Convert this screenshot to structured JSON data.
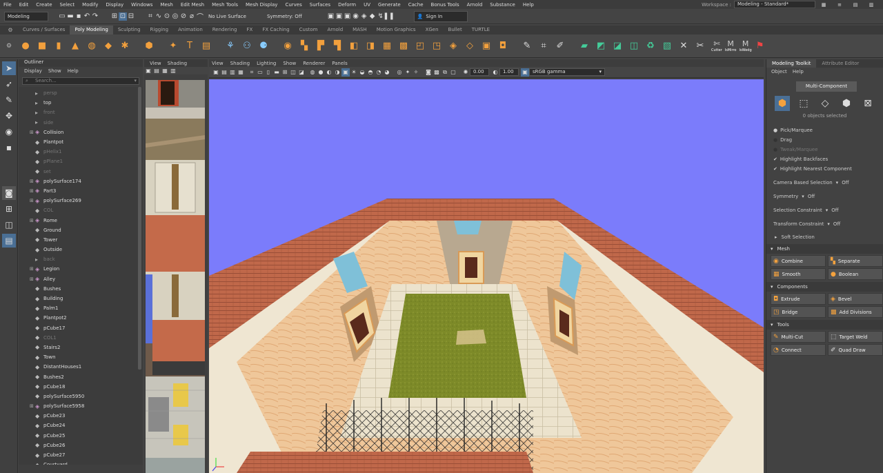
{
  "menubar": {
    "items": [
      "File",
      "Edit",
      "Create",
      "Select",
      "Modify",
      "Display",
      "Windows",
      "Mesh",
      "Edit Mesh",
      "Mesh Tools",
      "Mesh Display",
      "Curves",
      "Surfaces",
      "Deform",
      "UV",
      "Generate",
      "Cache",
      "Bonus Tools",
      "Arnold",
      "Substance",
      "Help"
    ],
    "workspace_label": "Workspace :",
    "workspace_value": "Modeling - Standard*"
  },
  "statusline": {
    "mode": "Modeling",
    "live_surface": "No Live Surface",
    "symmetry": "Symmetry: Off",
    "sign_in": "Sign In"
  },
  "shelf": {
    "tabs": [
      "Curves / Surfaces",
      "Poly Modeling",
      "Sculpting",
      "Rigging",
      "Animation",
      "Rendering",
      "FX",
      "FX Caching",
      "Custom",
      "Arnold",
      "MASH",
      "Motion Graphics",
      "XGen",
      "Bullet",
      "TURTLE"
    ],
    "active_tab": "Poly Modeling",
    "right_labels": [
      "Cutter",
      "IsMirro",
      "IsWedg"
    ]
  },
  "outliner": {
    "title": "Outliner",
    "menu": [
      "Display",
      "Show",
      "Help"
    ],
    "search_placeholder": "Search...",
    "items": [
      {
        "name": "persp",
        "dim": true,
        "kind": "cam",
        "group": false
      },
      {
        "name": "top",
        "dim": false,
        "kind": "cam",
        "group": false
      },
      {
        "name": "front",
        "dim": true,
        "kind": "cam",
        "group": false
      },
      {
        "name": "side",
        "dim": true,
        "kind": "cam",
        "group": false
      },
      {
        "name": "Collision",
        "dim": false,
        "kind": "mesh",
        "group": true
      },
      {
        "name": "Plantpot",
        "dim": false,
        "kind": "grp",
        "group": false
      },
      {
        "name": "pHelix1",
        "dim": true,
        "kind": "grp",
        "group": false
      },
      {
        "name": "pPlane1",
        "dim": true,
        "kind": "grp",
        "group": false
      },
      {
        "name": "set",
        "dim": true,
        "kind": "grp",
        "group": false
      },
      {
        "name": "polySurface174",
        "dim": false,
        "kind": "mesh",
        "group": true
      },
      {
        "name": "Part3",
        "dim": false,
        "kind": "mesh",
        "group": true
      },
      {
        "name": "polySurface269",
        "dim": false,
        "kind": "mesh",
        "group": true
      },
      {
        "name": "COL",
        "dim": true,
        "kind": "grp",
        "group": false
      },
      {
        "name": "Rome",
        "dim": false,
        "kind": "mesh",
        "group": true
      },
      {
        "name": "Ground",
        "dim": false,
        "kind": "grp",
        "group": false
      },
      {
        "name": "Tower",
        "dim": false,
        "kind": "grp",
        "group": false
      },
      {
        "name": "Outside",
        "dim": false,
        "kind": "grp",
        "group": false
      },
      {
        "name": "back",
        "dim": true,
        "kind": "cam",
        "group": false
      },
      {
        "name": "Legion",
        "dim": false,
        "kind": "mesh",
        "group": true
      },
      {
        "name": "Alley",
        "dim": false,
        "kind": "mesh",
        "group": true
      },
      {
        "name": "Bushes",
        "dim": false,
        "kind": "grp",
        "group": false
      },
      {
        "name": "Building",
        "dim": false,
        "kind": "grp",
        "group": false
      },
      {
        "name": "Palm1",
        "dim": false,
        "kind": "grp",
        "group": false
      },
      {
        "name": "Plantpot2",
        "dim": false,
        "kind": "grp",
        "group": false
      },
      {
        "name": "pCube17",
        "dim": false,
        "kind": "grp",
        "group": false
      },
      {
        "name": "COL1",
        "dim": true,
        "kind": "grp",
        "group": false
      },
      {
        "name": "Stairs2",
        "dim": false,
        "kind": "grp",
        "group": false
      },
      {
        "name": "Town",
        "dim": false,
        "kind": "grp",
        "group": false
      },
      {
        "name": "DistantHouses1",
        "dim": false,
        "kind": "grp",
        "group": false
      },
      {
        "name": "Bushes2",
        "dim": false,
        "kind": "grp",
        "group": false
      },
      {
        "name": "pCube18",
        "dim": false,
        "kind": "grp",
        "group": false
      },
      {
        "name": "polySurface5950",
        "dim": false,
        "kind": "grp",
        "group": false
      },
      {
        "name": "polySurface5958",
        "dim": false,
        "kind": "mesh",
        "group": true
      },
      {
        "name": "pCube23",
        "dim": false,
        "kind": "grp",
        "group": false
      },
      {
        "name": "pCube24",
        "dim": false,
        "kind": "grp",
        "group": false
      },
      {
        "name": "pCube25",
        "dim": false,
        "kind": "grp",
        "group": false
      },
      {
        "name": "pCube26",
        "dim": false,
        "kind": "grp",
        "group": false
      },
      {
        "name": "pCube27",
        "dim": false,
        "kind": "grp",
        "group": false
      },
      {
        "name": "Courtyard",
        "dim": false,
        "kind": "grp",
        "group": false
      }
    ]
  },
  "viewport_small": {
    "menu": [
      "View",
      "Shading"
    ]
  },
  "viewport_main": {
    "menu": [
      "View",
      "Shading",
      "Lighting",
      "Show",
      "Renderer",
      "Panels"
    ],
    "field1": "0.00",
    "field2": "1.00",
    "color_space": "sRGB gamma"
  },
  "toolkit": {
    "tabs": [
      "Modeling Toolkit",
      "Attribute Editor"
    ],
    "menu": [
      "Object",
      "Help"
    ],
    "multi_component": "Multi-Component",
    "objects_selected": "0 objects selected",
    "pick_marquee": "Pick/Marquee",
    "drag": "Drag",
    "tweak_marquee": "Tweak/Marquee",
    "highlight_backfaces": "Highlight Backfaces",
    "highlight_nearest": "Highlight Nearest Component",
    "camera_selection": "Camera Based Selection",
    "camera_selection_val": "Off",
    "symmetry": "Symmetry",
    "symmetry_val": "Off",
    "selection_constraint": "Selection Constraint",
    "selection_constraint_val": "Off",
    "transform_constraint": "Transform Constraint",
    "transform_constraint_val": "Off",
    "soft_selection": "Soft Selection",
    "mesh_title": "Mesh",
    "combine": "Combine",
    "separate": "Separate",
    "smooth": "Smooth",
    "boolean": "Boolean",
    "components_title": "Components",
    "extrude": "Extrude",
    "bevel": "Bevel",
    "bridge": "Bridge",
    "add_divisions": "Add Divisions",
    "tools_title": "Tools",
    "multi_cut": "Multi-Cut",
    "target_weld": "Target Weld",
    "connect": "Connect",
    "quad_draw": "Quad Draw"
  },
  "colors": {
    "sky": "#7b7cfb",
    "roof": "#c06b4c",
    "grass": "#7e8a2a",
    "accent": "#5aa0d8",
    "selected": "#4a6f95"
  }
}
